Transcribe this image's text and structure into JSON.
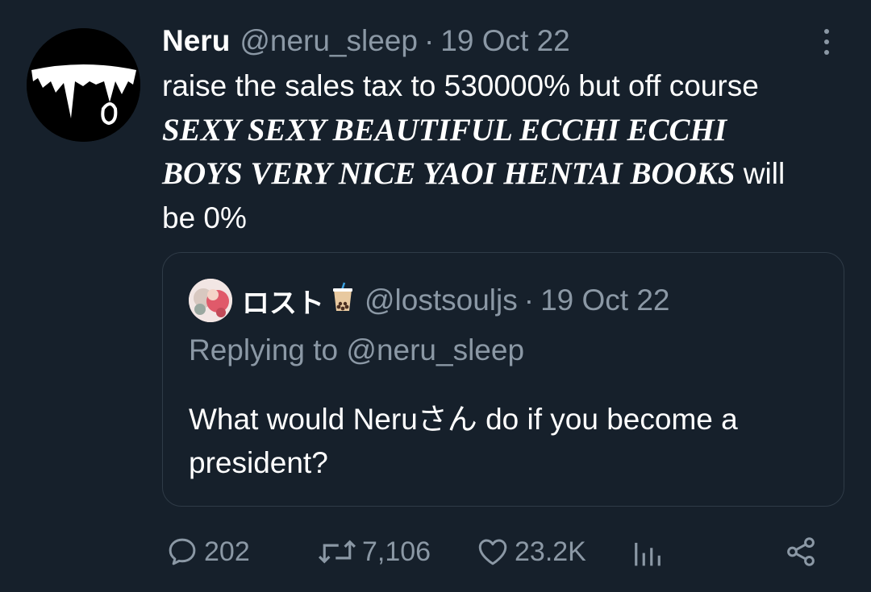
{
  "tweet": {
    "author_name": "Neru",
    "author_handle": "@neru_sleep",
    "separator": "·",
    "date": "19 Oct 22",
    "text_plain_1": "raise the sales tax to 530000% but off course ",
    "text_emphasis": "SEXY SEXY BEAUTIFUL ECCHI ECCHI BOYS VERY NICE YAOI HENTAI BOOKS",
    "text_plain_2": " will be 0%",
    "more_icon": "more-vertical-icon"
  },
  "quoted": {
    "author_name": "ロスト",
    "emoji_icon": "bubble-tea-icon",
    "author_handle": "@lostsouljs",
    "separator": "·",
    "date": "19 Oct 22",
    "replying_prefix": "Replying to ",
    "replying_handle": "@neru_sleep",
    "text": "What would Neruさん do if you become a president?"
  },
  "actions": {
    "replies": "202",
    "retweets": "7,106",
    "likes": "23.2K"
  },
  "colors": {
    "background": "#16202b",
    "muted": "#8b98a5",
    "border": "#2f3b47",
    "text": "#ffffff"
  }
}
